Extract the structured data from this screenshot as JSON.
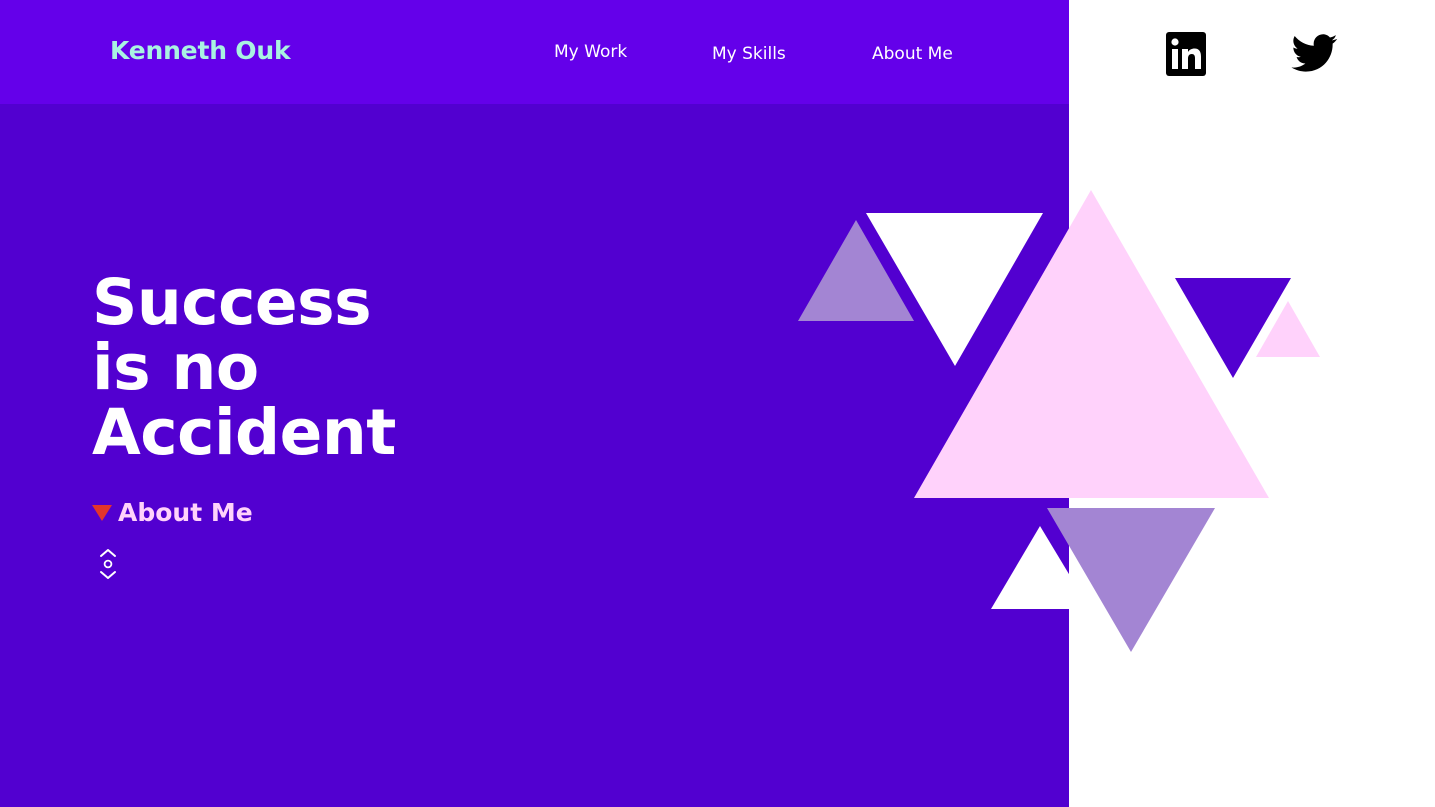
{
  "header": {
    "brand": "Kenneth Ouk",
    "nav": [
      {
        "label": "My Work"
      },
      {
        "label": "My Skills"
      },
      {
        "label": "About Me"
      }
    ]
  },
  "social": {
    "linkedin_icon": "linkedin-icon",
    "twitter_icon": "twitter-icon"
  },
  "hero": {
    "headline_lines": [
      "Success",
      "is no",
      "Accident"
    ],
    "cta_label": "About Me",
    "cta_icon": "red-triangle-pointed-down",
    "scroll_icon": "scroll-indicator-icon"
  },
  "colors": {
    "hero_bg": "#5200d0",
    "nav_bg": "#6400ea",
    "brand": "#a9f3e1",
    "cta": "#ffd2fb",
    "triangle_pink": "#ffd2fb",
    "triangle_lavender": "#a385d3"
  }
}
